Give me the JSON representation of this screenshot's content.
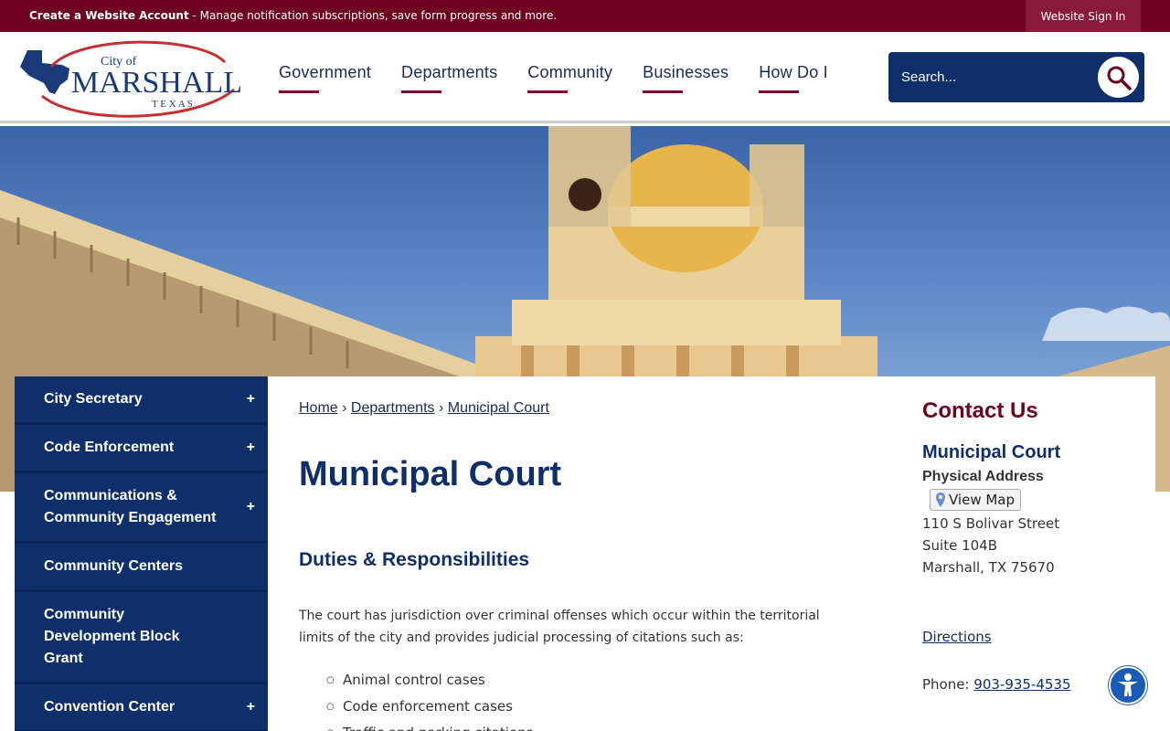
{
  "topbar": {
    "create_account": "Create a Website Account",
    "create_desc": " - Manage notification subscriptions, save form progress and more.",
    "signin": "Website Sign In"
  },
  "logo": {
    "line1": "City of",
    "line2": "MARSHALL",
    "line3": "T E X A S"
  },
  "nav": [
    "Government",
    "Departments",
    "Community",
    "Businesses",
    "How Do I"
  ],
  "search": {
    "placeholder": "Search..."
  },
  "sidebar": {
    "items": [
      {
        "label": "City Secretary",
        "expand": "+"
      },
      {
        "label": "Code Enforcement",
        "expand": "+"
      },
      {
        "label": "Communications & Community Engagement",
        "expand": "+"
      },
      {
        "label": "Community Centers",
        "expand": ""
      },
      {
        "label": "Community Development Block Grant",
        "expand": ""
      },
      {
        "label": "Convention Center",
        "expand": "+"
      }
    ]
  },
  "breadcrumb": {
    "home": "Home",
    "sep": "›",
    "departments": "Departments",
    "current": "Municipal Court"
  },
  "main": {
    "title": "Municipal Court",
    "section": "Duties & Responsibilities",
    "paragraph": "The court has jurisdiction over criminal offenses which occur within the territorial limits of the city and provides judicial processing of citations such as:",
    "list": [
      "Animal control cases",
      "Code enforcement cases",
      "Traffic and parking citations"
    ]
  },
  "contact": {
    "heading": "Contact Us",
    "dept": "Municipal Court",
    "address_label": "Physical Address",
    "view_map": "View Map",
    "street": "110 S Bolivar Street",
    "suite": "Suite 104B",
    "city": "Marshall, TX 75670",
    "directions": "Directions",
    "phone_label": "Phone: ",
    "phone": "903-935-4535"
  },
  "colors": {
    "maroon": "#6e0020",
    "navy": "#0f2f6b"
  }
}
